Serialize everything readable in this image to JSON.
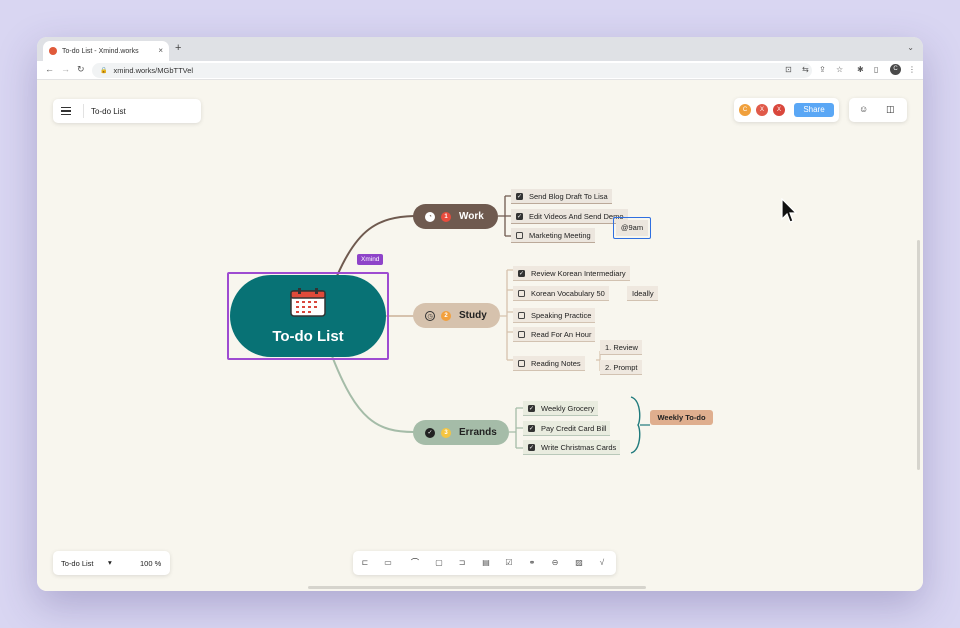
{
  "browser": {
    "tab_title": "To-do List - Xmind.works",
    "tab_close": "×",
    "new_tab": "+",
    "url": "xmind.works/MGbTTVel",
    "profile_initial": "C"
  },
  "app": {
    "doc_title": "To-do List",
    "avatars": [
      {
        "initial": "C",
        "color": "#f0a03c"
      },
      {
        "initial": "X",
        "color": "#e05a4a"
      },
      {
        "initial": "X",
        "color": "#d9473c"
      }
    ],
    "share_label": "Share",
    "zoom_doc": "To-do List",
    "zoom_level": "100 %"
  },
  "map": {
    "central": {
      "title": "To-do List",
      "tag": "Xmind",
      "color": "#087275"
    },
    "work": {
      "label": "Work",
      "number": "1",
      "items": [
        {
          "text": "Send Blog Draft To Lisa",
          "checked": true
        },
        {
          "text": "Edit Videos And Send Demo",
          "checked": true
        },
        {
          "text": "Marketing Meeting",
          "checked": false
        }
      ],
      "meeting_tag": "@9am"
    },
    "study": {
      "label": "Study",
      "number": "2",
      "items": [
        {
          "text": "Review Korean Intermediary",
          "checked": true
        },
        {
          "text": "Korean Vocabulary 50",
          "checked": false
        },
        {
          "text": "Speaking Practice",
          "checked": false
        },
        {
          "text": "Read For An Hour",
          "checked": false
        },
        {
          "text": "Reading Notes",
          "checked": false
        }
      ],
      "vocab_tag": "Ideally",
      "notes": [
        "1. Review",
        "2. Prompt"
      ]
    },
    "errands": {
      "label": "Errands",
      "number": "3",
      "items": [
        {
          "text": "Weekly Grocery",
          "checked": true
        },
        {
          "text": "Pay Credit Card Bill",
          "checked": true
        },
        {
          "text": "Write Christmas Cards",
          "checked": true
        }
      ],
      "summary": "Weekly To-do"
    }
  }
}
